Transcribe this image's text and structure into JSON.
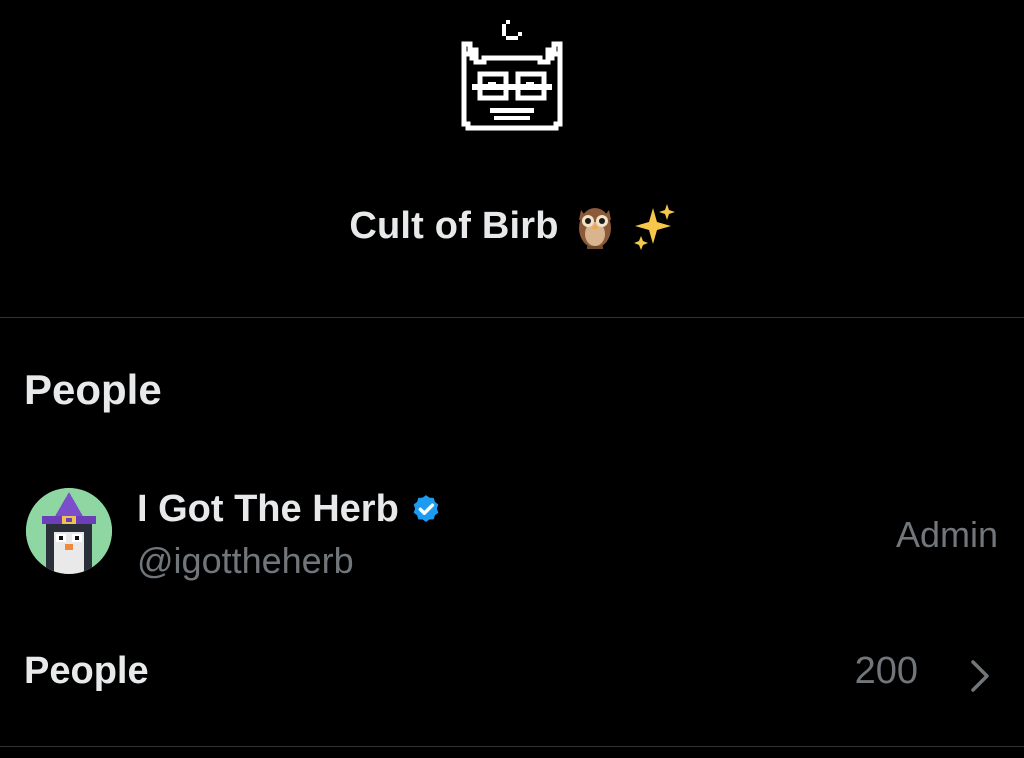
{
  "community": {
    "logo_icon": "pixel-cat-logo-icon",
    "name": "Cult of Birb",
    "emojis": [
      "owl-emoji",
      "sparkles-emoji"
    ]
  },
  "people_section": {
    "title": "People",
    "members": [
      {
        "display_name": "I Got The Herb",
        "verified": true,
        "handle": "@igottheherb",
        "role": "Admin",
        "avatar_icon": "wizard-penguin-avatar"
      }
    ]
  },
  "people_row": {
    "label": "People",
    "count": "200",
    "chevron_icon": "chevron-right-icon"
  },
  "colors": {
    "background": "#000000",
    "text_primary": "#e7e9ea",
    "text_secondary": "#71767b",
    "divider": "#2f3336",
    "verified_blue": "#1d9bf0"
  }
}
